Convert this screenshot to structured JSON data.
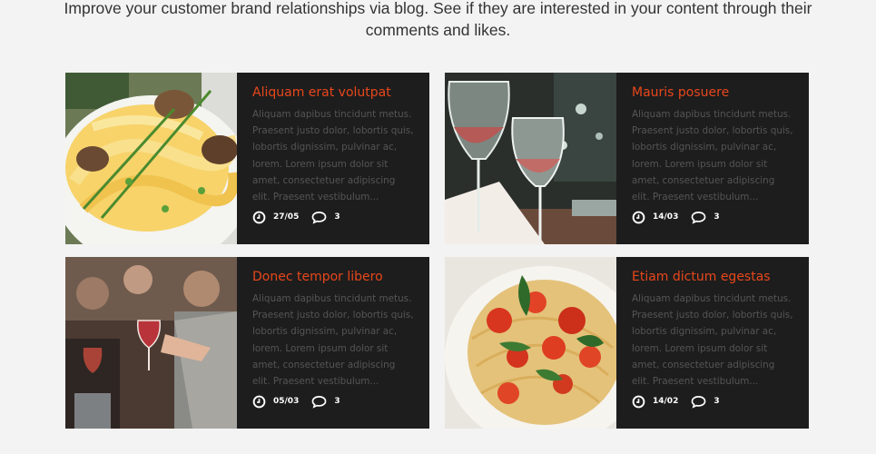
{
  "intro": {
    "line1": "Improve your customer brand relationships via blog. See if they are interested in your content through their",
    "line2": "comments and likes."
  },
  "posts": [
    {
      "title": "Aliquam erat volutpat",
      "excerpt": "Aliquam dapibus tincidunt metus. Praesent justo dolor, lobortis quis, lobortis dignissim, pulvinar ac, lorem. Lorem ipsum dolor sit amet, consectetuer adipiscing elit. Praesent vestibulum...",
      "date": "27/05",
      "comments": "3",
      "image": "pasta-with-mushrooms-photo"
    },
    {
      "title": "Mauris posuere",
      "excerpt": "Aliquam dapibus tincidunt metus. Praesent justo dolor, lobortis quis, lobortis dignissim, pulvinar ac, lorem. Lorem ipsum dolor sit amet, consectetuer adipiscing elit. Praesent vestibulum...",
      "date": "14/03",
      "comments": "3",
      "image": "wine-glasses-photo"
    },
    {
      "title": "Donec tempor libero",
      "excerpt": "Aliquam dapibus tincidunt metus. Praesent justo dolor, lobortis quis, lobortis dignissim, pulvinar ac, lorem. Lorem ipsum dolor sit amet, consectetuer adipiscing elit. Praesent vestibulum...",
      "date": "05/03",
      "comments": "3",
      "image": "party-toast-photo"
    },
    {
      "title": "Etiam dictum egestas",
      "excerpt": "Aliquam dapibus tincidunt metus. Praesent justo dolor, lobortis quis, lobortis dignissim, pulvinar ac, lorem. Lorem ipsum dolor sit amet, consectetuer adipiscing elit. Praesent vestibulum...",
      "date": "14/02",
      "comments": "3",
      "image": "spaghetti-tomato-photo"
    }
  ],
  "icons": {
    "date": "clock-icon",
    "comments": "comment-bubble-icon"
  },
  "colors": {
    "background": "#f3f3f3",
    "card": "#1d1d1d",
    "accent": "#e8471b",
    "excerpt_text": "#555555",
    "meta_text": "#ffffff"
  }
}
